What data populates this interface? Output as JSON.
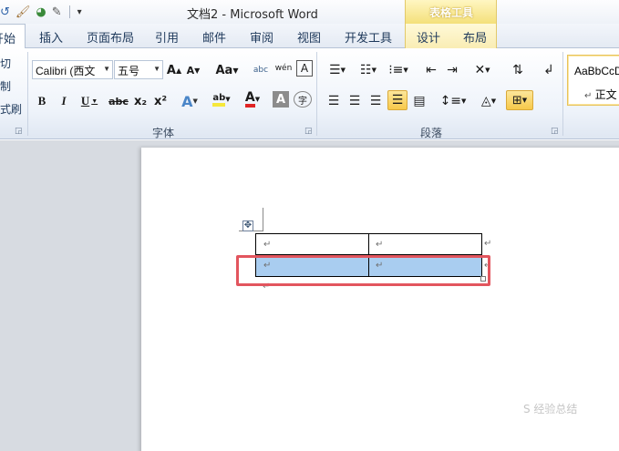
{
  "window": {
    "title": "文档2 - Microsoft Word",
    "context_tool": "表格工具"
  },
  "quick_access": {
    "icons": [
      "word-logo-icon",
      "format-painter-icon",
      "color-circle-icon",
      "strikethrough-draw-icon",
      "qat-dropdown-icon"
    ]
  },
  "tabs": [
    {
      "label": "开始",
      "active": true
    },
    {
      "label": "插入"
    },
    {
      "label": "页面布局"
    },
    {
      "label": "引用"
    },
    {
      "label": "邮件"
    },
    {
      "label": "审阅"
    },
    {
      "label": "视图"
    },
    {
      "label": "开发工具"
    },
    {
      "label": "设计"
    },
    {
      "label": "布局"
    }
  ],
  "clipboard": {
    "items": [
      "切",
      "制",
      "式刷"
    ]
  },
  "font": {
    "group_label": "字体",
    "font_name": "Calibri (西文",
    "font_size": "五号",
    "row1_buttons": [
      "A",
      "A",
      "Aa",
      "abc",
      "wén",
      "A"
    ],
    "row2_buttons": [
      "B",
      "I",
      "U",
      "abc",
      "x₂",
      "x²",
      "A",
      "ab",
      "A",
      "A",
      "字"
    ]
  },
  "paragraph": {
    "group_label": "段落"
  },
  "styles": {
    "sample": "AaBbCcD",
    "style_name": "正文"
  },
  "document": {
    "paragraph_mark": "↵"
  },
  "watermark": "S 经验总结"
}
